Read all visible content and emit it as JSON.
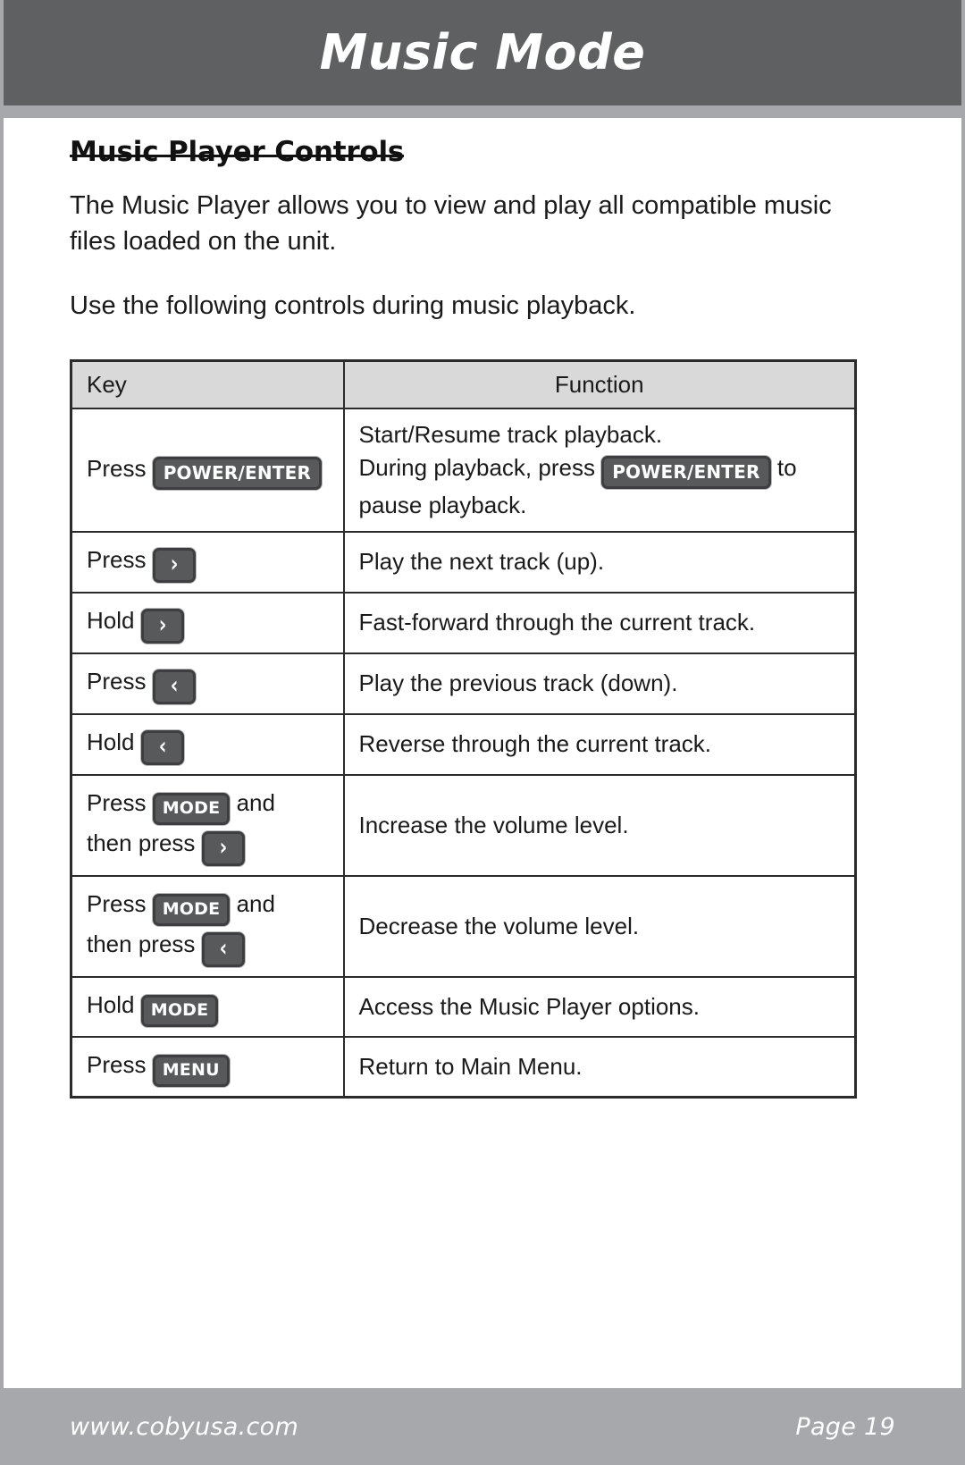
{
  "banner": {
    "title": "Music Mode"
  },
  "section": {
    "heading": "Music Player Controls",
    "paragraph_1": "The Music Player allows you to view and play all compatible music files loaded on the unit.",
    "paragraph_2": "Use the following controls during music playback."
  },
  "table": {
    "headers": {
      "key": "Key",
      "function": "Function"
    },
    "rows": [
      {
        "key": {
          "prefix": "Press",
          "badge": "POWER/ENTER"
        },
        "function": {
          "line_1": "Start/Resume track playback.",
          "line_2_before": "During playback, press",
          "line_2_badge": "POWER/ENTER",
          "line_2_after": "to",
          "line_3": "pause playback."
        }
      },
      {
        "key": {
          "prefix": "Press",
          "badge": "›",
          "badge_type": "arrow",
          "badge_name": "right-arrow"
        },
        "function": {
          "line_1": "Play the next track (up)."
        }
      },
      {
        "key": {
          "prefix": "Hold",
          "badge": "›",
          "badge_type": "arrow",
          "badge_name": "right-arrow"
        },
        "function": {
          "line_1": "Fast-forward through the current track."
        }
      },
      {
        "key": {
          "prefix": "Press",
          "badge": "‹",
          "badge_type": "arrow",
          "badge_name": "left-arrow"
        },
        "function": {
          "line_1": "Play the previous track (down)."
        }
      },
      {
        "key": {
          "prefix": "Hold",
          "badge": "‹",
          "badge_type": "arrow",
          "badge_name": "left-arrow"
        },
        "function": {
          "line_1": "Reverse through the current track."
        }
      },
      {
        "key": {
          "prefix": "Press",
          "badge": "MODE",
          "suffix": "and",
          "line_2_before": "then press",
          "line_2_badge": "›",
          "line_2_badge_type": "arrow"
        },
        "function": {
          "line_1": "Increase the volume level."
        }
      },
      {
        "key": {
          "prefix": "Press",
          "badge": "MODE",
          "suffix": "and",
          "line_2_before": "then press",
          "line_2_badge": "‹",
          "line_2_badge_type": "arrow"
        },
        "function": {
          "line_1": "Decrease the volume level."
        }
      },
      {
        "key": {
          "prefix": "Hold",
          "badge": "MODE"
        },
        "function": {
          "line_1": "Access the Music Player options."
        }
      },
      {
        "key": {
          "prefix": "Press",
          "badge": "MENU"
        },
        "function": {
          "line_1": "Return to Main Menu."
        }
      }
    ]
  },
  "footer": {
    "website": "www.cobyusa.com",
    "page": "Page 19"
  },
  "colors": {
    "banner_bg": "#5e6062",
    "rule_bg": "#a6a8ab",
    "footer_bg": "#a6a8ab",
    "table_header_bg": "#d9d9d9",
    "badge_bg": "#58595b",
    "border": "#2b2b2b"
  }
}
